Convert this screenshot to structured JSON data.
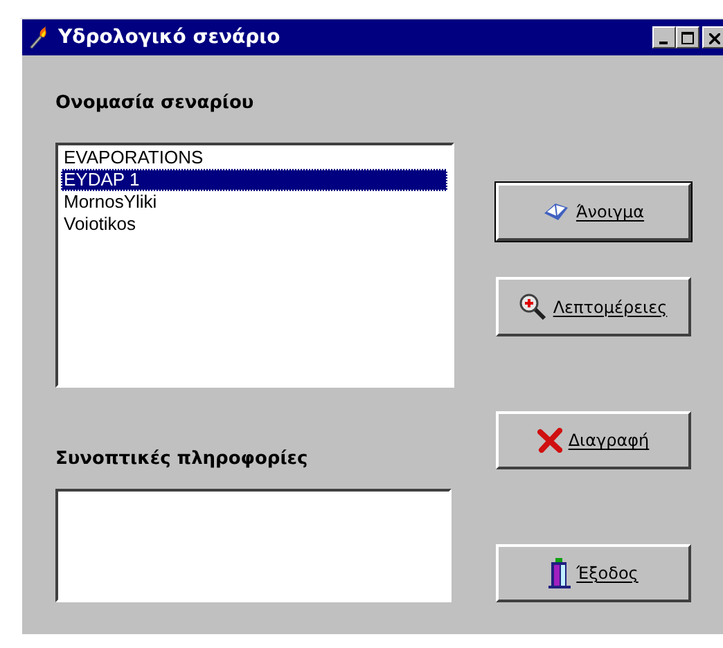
{
  "window": {
    "title": "Υδρολογικό σενάριο"
  },
  "scenario_label": "Ονομασία σεναρίου",
  "scenarios": [
    {
      "name": "EVAPORATIONS",
      "selected": false
    },
    {
      "name": "EYDAP 1",
      "selected": true
    },
    {
      "name": "MornosYliki",
      "selected": false
    },
    {
      "name": "Voiotikos",
      "selected": false
    }
  ],
  "summary_label": "Συνοπτικές πληροφορίες",
  "buttons": [
    {
      "kind": "open",
      "label": "Άνοιγμα",
      "default": true
    },
    {
      "kind": "details",
      "label": "Λεπτομέρειες",
      "default": false
    },
    {
      "kind": "delete",
      "label": "Διαγραφή",
      "default": false
    },
    {
      "kind": "exit",
      "label": "Έξοδος",
      "default": false
    }
  ]
}
